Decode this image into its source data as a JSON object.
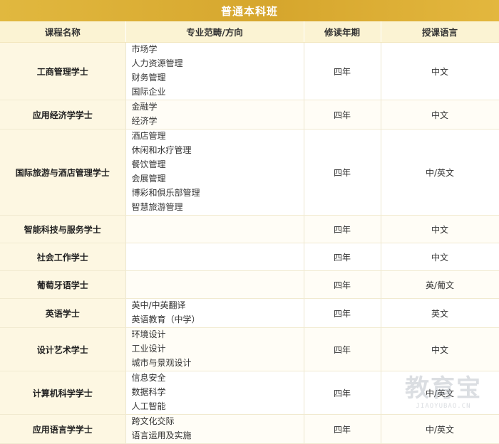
{
  "page": {
    "title": "普通本科班"
  },
  "table": {
    "headers": [
      "课程名称",
      "专业范畴/方向",
      "修读年期",
      "授课语言"
    ],
    "rows": [
      {
        "name": "工商管理学士",
        "specs": [
          "市场学",
          "人力资源管理",
          "财务管理",
          "国际企业"
        ],
        "years": "四年",
        "language": "中文"
      },
      {
        "name": "应用经济学学士",
        "specs": [
          "金融学",
          "经济学"
        ],
        "years": "四年",
        "language": "中文"
      },
      {
        "name": "国际旅游与酒店管理学士",
        "specs": [
          "酒店管理",
          "休闲和水疗管理",
          "餐饮管理",
          "会展管理",
          "博彩和俱乐部管理",
          "智慧旅游管理"
        ],
        "years": "四年",
        "language": "中/英文"
      },
      {
        "name": "智能科技与服务学士",
        "specs": [],
        "years": "四年",
        "language": "中文"
      },
      {
        "name": "社会工作学士",
        "specs": [],
        "years": "四年",
        "language": "中文"
      },
      {
        "name": "葡萄牙语学士",
        "specs": [],
        "years": "四年",
        "language": "英/葡文"
      },
      {
        "name": "英语学士",
        "specs": [
          "英中/中英翻译",
          "英语教育（中学）"
        ],
        "years": "四年",
        "language": "英文"
      },
      {
        "name": "设计艺术学士",
        "specs": [
          "环境设计",
          "工业设计",
          "城市与景观设计"
        ],
        "years": "四年",
        "language": "中文"
      },
      {
        "name": "计算机科学学士",
        "specs": [
          "信息安全",
          "数据科学",
          "人工智能"
        ],
        "years": "四年",
        "language": "中/英文"
      },
      {
        "name": "应用语言学学士",
        "specs": [
          "跨文化交际",
          "语言运用及实施"
        ],
        "years": "四年",
        "language": "中/英文"
      }
    ]
  },
  "watermark": {
    "main": "教育宝",
    "sub": "JIAOYUBAO.CN"
  }
}
